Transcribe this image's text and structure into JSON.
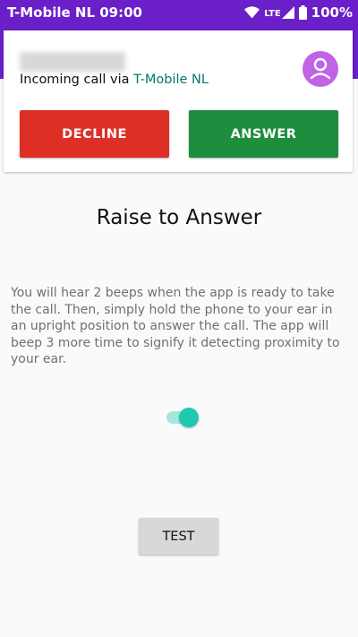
{
  "status_bar": {
    "carrier": "T-Mobile  NL",
    "time": "09:00",
    "network_type": "LTE",
    "battery": "100%",
    "icons": [
      "wifi-icon",
      "signal-icon",
      "battery-icon"
    ]
  },
  "call_card": {
    "incoming_prefix": "Incoming call via ",
    "network_name": "T-Mobile  NL",
    "decline_label": "DECLINE",
    "answer_label": "ANSWER",
    "avatar_icon": "person-icon"
  },
  "main": {
    "title": "Raise to Answer",
    "description": "You will hear 2 beeps when the app is ready to take the call. Then, simply hold the phone to your ear in an upright position to answer the call. The app will beep 3 more time to signify it detecting proximity to your ear.",
    "toggle_on": true,
    "test_label": "TEST"
  },
  "colors": {
    "status_bar": "#6a1fc9",
    "decline": "#de2f27",
    "answer": "#1e8e3e",
    "network_text": "#00796b",
    "avatar": "#c063e6",
    "toggle": "#1fc9b0"
  }
}
